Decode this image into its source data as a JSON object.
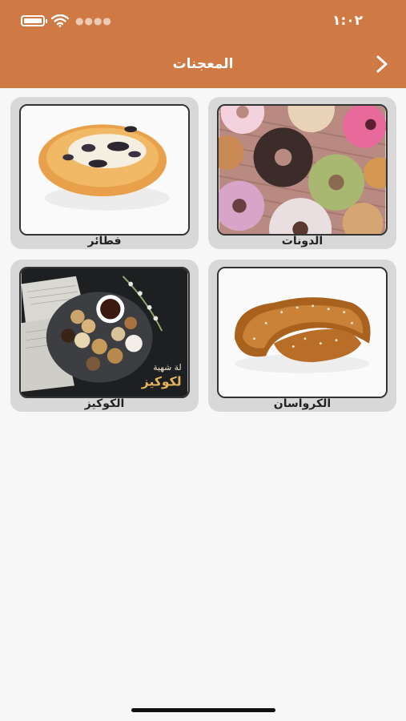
{
  "status_bar": {
    "time": "١:٠٢"
  },
  "header": {
    "title": "المعجنات"
  },
  "categories": [
    {
      "label": "الدونات",
      "image": "donuts"
    },
    {
      "label": "فطائر",
      "image": "pie"
    },
    {
      "label": "الكرواسان",
      "image": "croissant"
    },
    {
      "label": "الكوكيز",
      "image": "cookies",
      "image_caption_line1": "لة شهية",
      "image_caption_line2": "لكوكيز"
    }
  ],
  "colors": {
    "header": "#cf7a45",
    "background": "#f7f7f7",
    "card": "#d8d8d8"
  }
}
